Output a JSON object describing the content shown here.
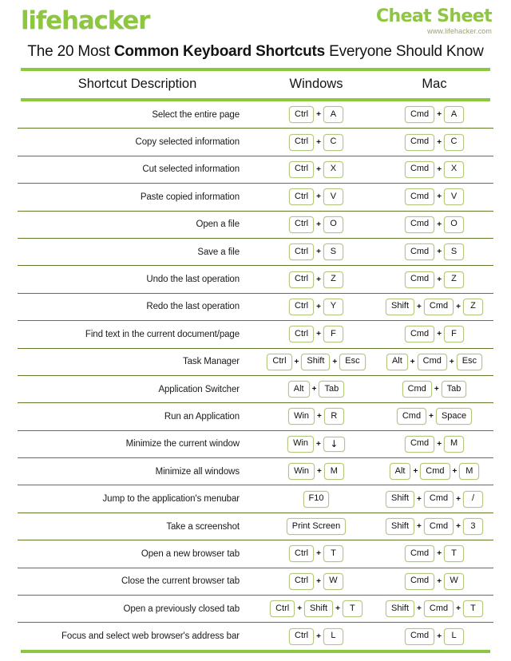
{
  "brand": {
    "logo": "lifehacker",
    "cheat_sheet": "Cheat Sheet",
    "url": "www.lifehacker.com"
  },
  "title": {
    "part1": "The 20 Most ",
    "bold": "Common Keyboard Shortcuts",
    "part2": " Everyone Should Know"
  },
  "colors": {
    "brand_green": "#8DC63F",
    "rule_dark": "#61792c",
    "key_border": "#b4c97f"
  },
  "table": {
    "headers": {
      "description": "Shortcut Description",
      "windows": "Windows",
      "mac": "Mac"
    },
    "rows": [
      {
        "description": "Select the entire page",
        "windows": [
          "Ctrl",
          "A"
        ],
        "mac": [
          "Cmd",
          "A"
        ]
      },
      {
        "description": "Copy selected information",
        "windows": [
          "Ctrl",
          "C"
        ],
        "mac": [
          "Cmd",
          "C"
        ]
      },
      {
        "description": "Cut selected information",
        "windows": [
          "Ctrl",
          "X"
        ],
        "mac": [
          "Cmd",
          "X"
        ]
      },
      {
        "description": "Paste copied information",
        "windows": [
          "Ctrl",
          "V"
        ],
        "mac": [
          "Cmd",
          "V"
        ]
      },
      {
        "description": "Open a file",
        "windows": [
          "Ctrl",
          "O"
        ],
        "mac": [
          "Cmd",
          "O"
        ]
      },
      {
        "description": "Save a file",
        "windows": [
          "Ctrl",
          "S"
        ],
        "mac": [
          "Cmd",
          "S"
        ]
      },
      {
        "description": "Undo the last operation",
        "windows": [
          "Ctrl",
          "Z"
        ],
        "mac": [
          "Cmd",
          "Z"
        ]
      },
      {
        "description": "Redo the last operation",
        "windows": [
          "Ctrl",
          "Y"
        ],
        "mac": [
          "Shift",
          "Cmd",
          "Z"
        ]
      },
      {
        "description": "Find text in the current document/page",
        "windows": [
          "Ctrl",
          "F"
        ],
        "mac": [
          "Cmd",
          "F"
        ]
      },
      {
        "description": "Task Manager",
        "windows": [
          "Ctrl",
          "Shift",
          "Esc"
        ],
        "mac": [
          "Alt",
          "Cmd",
          "Esc"
        ]
      },
      {
        "description": "Application Switcher",
        "windows": [
          "Alt",
          "Tab"
        ],
        "mac": [
          "Cmd",
          "Tab"
        ]
      },
      {
        "description": "Run an Application",
        "windows": [
          "Win",
          "R"
        ],
        "mac": [
          "Cmd",
          "Space"
        ]
      },
      {
        "description": "Minimize the current window",
        "windows": [
          "Win",
          "↓"
        ],
        "mac": [
          "Cmd",
          "M"
        ]
      },
      {
        "description": "Minimize all windows",
        "windows": [
          "Win",
          "M"
        ],
        "mac": [
          "Alt",
          "Cmd",
          "M"
        ]
      },
      {
        "description": "Jump to the application's menubar",
        "windows": [
          "F10"
        ],
        "mac": [
          "Shift",
          "Cmd",
          "/"
        ]
      },
      {
        "description": "Take a screenshot",
        "windows": [
          "Print Screen"
        ],
        "mac": [
          "Shift",
          "Cmd",
          "3"
        ]
      },
      {
        "description": "Open a new browser tab",
        "windows": [
          "Ctrl",
          "T"
        ],
        "mac": [
          "Cmd",
          "T"
        ]
      },
      {
        "description": "Close the current browser tab",
        "windows": [
          "Ctrl",
          "W"
        ],
        "mac": [
          "Cmd",
          "W"
        ]
      },
      {
        "description": "Open a previously closed tab",
        "windows": [
          "Ctrl",
          "Shift",
          "T"
        ],
        "mac": [
          "Shift",
          "Cmd",
          "T"
        ]
      },
      {
        "description": "Focus and select web browser's address bar",
        "windows": [
          "Ctrl",
          "L"
        ],
        "mac": [
          "Cmd",
          "L"
        ]
      }
    ]
  }
}
